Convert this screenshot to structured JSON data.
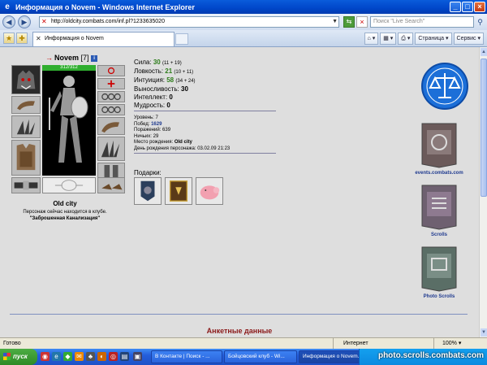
{
  "window": {
    "title": "Информация о Novem - Windows Internet Explorer"
  },
  "addressbar": {
    "url": "http://oldcity.combats.com/inf.pl?1233635020",
    "search_placeholder": "Поиск \"Live Search\""
  },
  "tabs": {
    "active_label": "Информация о Novem"
  },
  "toolbar": {
    "page_label": "Страница",
    "service_label": "Сервис"
  },
  "character": {
    "name": "Novem",
    "level_text": "[7]",
    "info_badge": "i",
    "hp_text": "312/312",
    "city": "Old city",
    "club_line1": "Персонаж сейчас находится в клубе.",
    "club_line2": "\"Заброшенная Канализация\""
  },
  "stats": [
    {
      "label": "Сила:",
      "value": "30",
      "extra": "(11 + 19)"
    },
    {
      "label": "Ловкость:",
      "value": "21",
      "extra": "(10 + 11)"
    },
    {
      "label": "Интуиция:",
      "value": "58",
      "extra": "(34 + 24)"
    },
    {
      "label": "Выносливость:",
      "value": "30",
      "extra": ""
    },
    {
      "label": "Интеллект:",
      "value": "0",
      "extra": ""
    },
    {
      "label": "Мудрость:",
      "value": "0",
      "extra": ""
    }
  ],
  "info": [
    {
      "label": "Уровень:",
      "value": "7"
    },
    {
      "label": "Побед:",
      "value": "1629"
    },
    {
      "label": "Поражений:",
      "value": "639"
    },
    {
      "label": "Ничьих:",
      "value": "29"
    },
    {
      "label": "Место рождения:",
      "value": "Old city"
    },
    {
      "label": "День рождения персонажа:",
      "value": "03.02.09 21:23"
    }
  ],
  "gifts": {
    "label": "Подарки:"
  },
  "right_badges": {
    "events": "events.combats.com",
    "scrolls": "Scrolls",
    "photo_scrolls": "Photo Scrolls"
  },
  "section_title": "Анкетные данные",
  "statusbar": {
    "status": "Готово",
    "zone": "Интернет",
    "zoom": "100%"
  },
  "taskbar": {
    "start": "пуск",
    "tasks": [
      "В Контакте | Поиск - ...",
      "Бойцовский клуб - Wi...",
      "Информация о Novem..."
    ],
    "watermark": "photo.scrolls.combats.com"
  },
  "colors": {
    "accent_blue": "#0a5cdb",
    "stat_green": "#2e7d1b",
    "section_red": "#8b1a1a",
    "badge_blue": "#1f3a8f"
  }
}
